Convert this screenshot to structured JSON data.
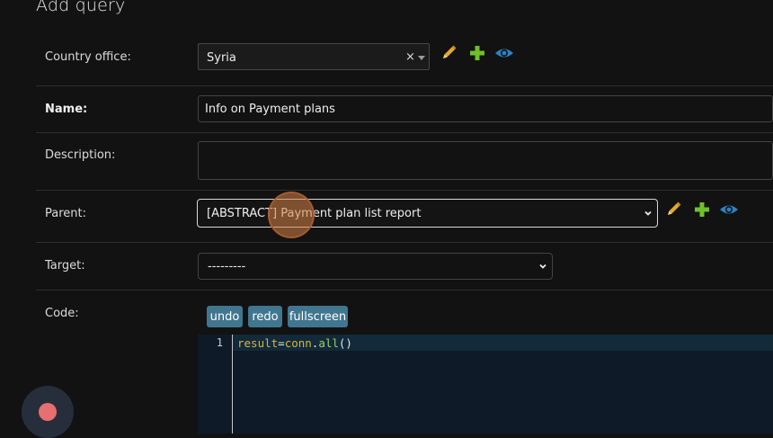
{
  "page": {
    "title": "Add query"
  },
  "fields": {
    "country_office": {
      "label": "Country office:",
      "value": "Syria",
      "clear": "×"
    },
    "name": {
      "label": "Name:",
      "value": "Info on Payment plans"
    },
    "description": {
      "label": "Description:",
      "value": ""
    },
    "parent": {
      "label": "Parent:",
      "value": "[ABSTRACT] Payment plan list report"
    },
    "target": {
      "label": "Target:",
      "value": "---------"
    },
    "code": {
      "label": "Code:",
      "buttons": {
        "undo": "undo",
        "redo": "redo",
        "fullscreen": "fullscreen"
      },
      "line_number": "1",
      "tokens": [
        "result",
        "=",
        "conn",
        ".",
        "all",
        "()"
      ]
    }
  },
  "colors": {
    "edit_icon": "#e0a82e",
    "add_icon": "#70bf2b",
    "view_icon": "#2d82c4",
    "button_bg": "#417690",
    "record_dot": "#e86f6f"
  },
  "icons": [
    "pencil-icon",
    "plus-icon",
    "eye-icon",
    "chevron-down-icon",
    "record-icon"
  ]
}
